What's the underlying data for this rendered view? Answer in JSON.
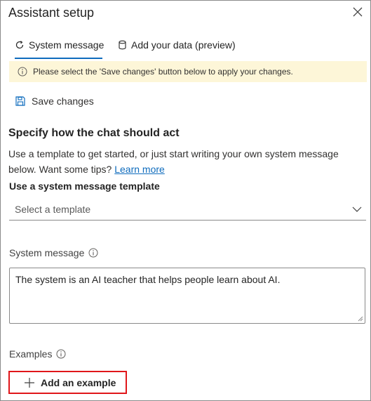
{
  "panel": {
    "title": "Assistant setup"
  },
  "tabs": [
    {
      "label": "System message",
      "icon": "refresh-icon",
      "active": true
    },
    {
      "label": "Add your data (preview)",
      "icon": "database-icon",
      "active": false
    }
  ],
  "banner": {
    "icon": "info-icon",
    "text": "Please select the 'Save changes' button below to apply your changes.",
    "color": "#fdf6d8"
  },
  "toolbar": {
    "save_label": "Save changes",
    "save_icon": "save-icon"
  },
  "section": {
    "heading": "Specify how the chat should act",
    "description_line1": "Use a template to get started, or just start writing your own system message",
    "description_line2": "below. Want some tips?",
    "learn_more": "Learn more"
  },
  "template": {
    "label": "Use a system message template",
    "placeholder": "Select a template"
  },
  "system_message": {
    "label": "System message",
    "value": "The system is an AI teacher that helps people learn about AI."
  },
  "examples": {
    "label": "Examples",
    "add_label": "Add an example"
  },
  "colors": {
    "accent": "#0f6cbd",
    "highlight_border": "#e0161a"
  }
}
